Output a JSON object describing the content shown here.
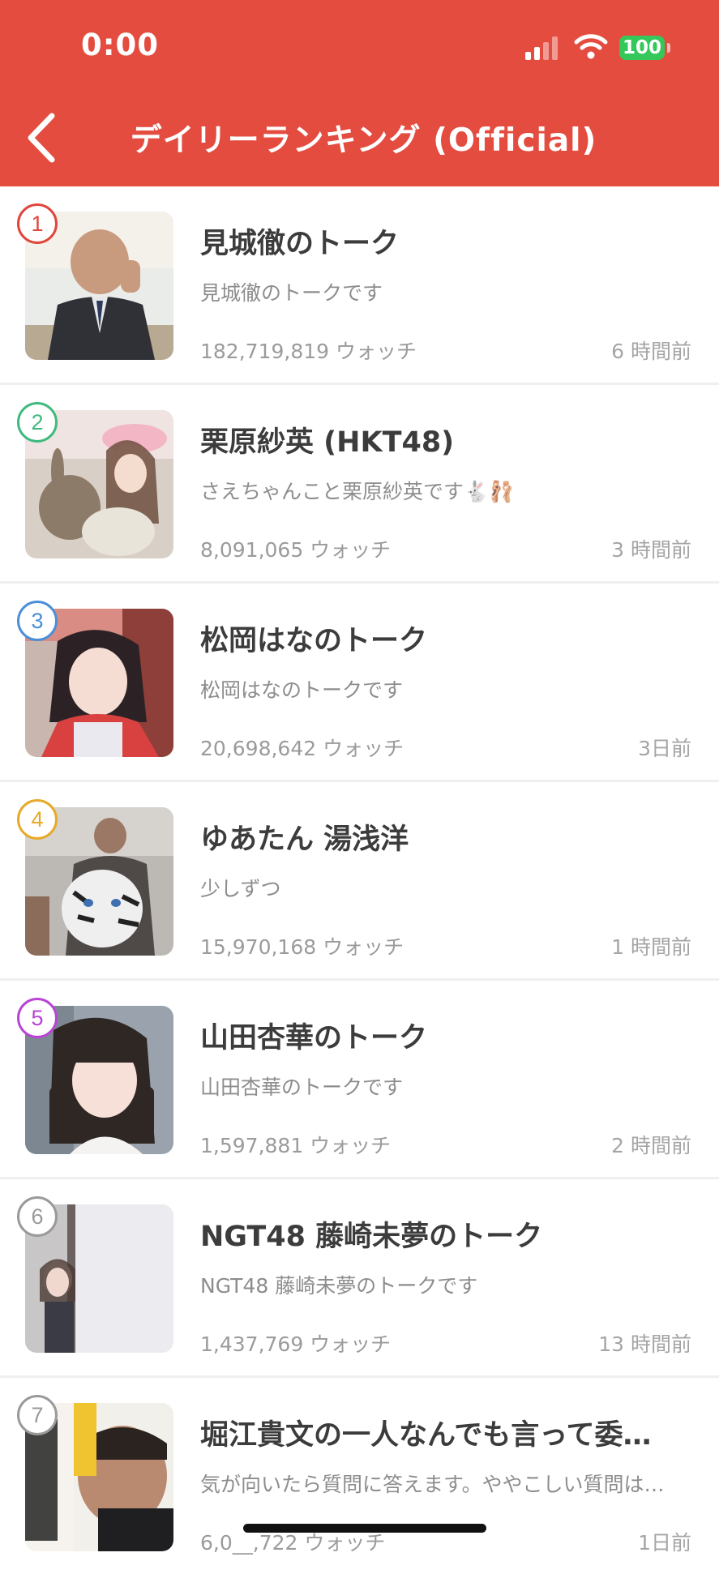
{
  "status_bar": {
    "time": "0:00",
    "battery": "100"
  },
  "header": {
    "title": "デイリーランキング (Official)",
    "back_icon": "chevron-left-icon",
    "background": "#e34c3f"
  },
  "ranking": [
    {
      "rank": "1",
      "rank_color": "#e0463c",
      "title": "見城徹のトーク",
      "description": "見城徹のトークです",
      "watch": "182,719,819 ウォッチ",
      "time": "6 時間前"
    },
    {
      "rank": "2",
      "rank_color": "#3fba7e",
      "title": "栗原紗英 (HKT48)",
      "description": "さえちゃんこと栗原紗英です🐇🩰",
      "watch": "8,091,065 ウォッチ",
      "time": "3 時間前"
    },
    {
      "rank": "3",
      "rank_color": "#4a8fd8",
      "title": "松岡はなのトーク",
      "description": "松岡はなのトークです",
      "watch": "20,698,642 ウォッチ",
      "time": "3日前"
    },
    {
      "rank": "4",
      "rank_color": "#e7a927",
      "title": "ゆあたん 湯浅洋",
      "description": "少しずつ",
      "watch": "15,970,168 ウォッチ",
      "time": "1 時間前"
    },
    {
      "rank": "5",
      "rank_color": "#b944d6",
      "title": "山田杏華のトーク",
      "description": "山田杏華のトークです",
      "watch": "1,597,881 ウォッチ",
      "time": "2 時間前"
    },
    {
      "rank": "6",
      "rank_color": "#9a9a9a",
      "title": "NGT48 藤崎未夢のトーク",
      "description": "NGT48 藤崎未夢のトークです",
      "watch": "1,437,769 ウォッチ",
      "time": "13 時間前"
    },
    {
      "rank": "7",
      "rank_color": "#9a9a9a",
      "title": "堀江貴文の一人なんでも言って委…",
      "description": "気が向いたら質問に答えます。ややこしい質問は…",
      "watch": "6,0__,722 ウォッチ",
      "time": "1日前"
    }
  ]
}
